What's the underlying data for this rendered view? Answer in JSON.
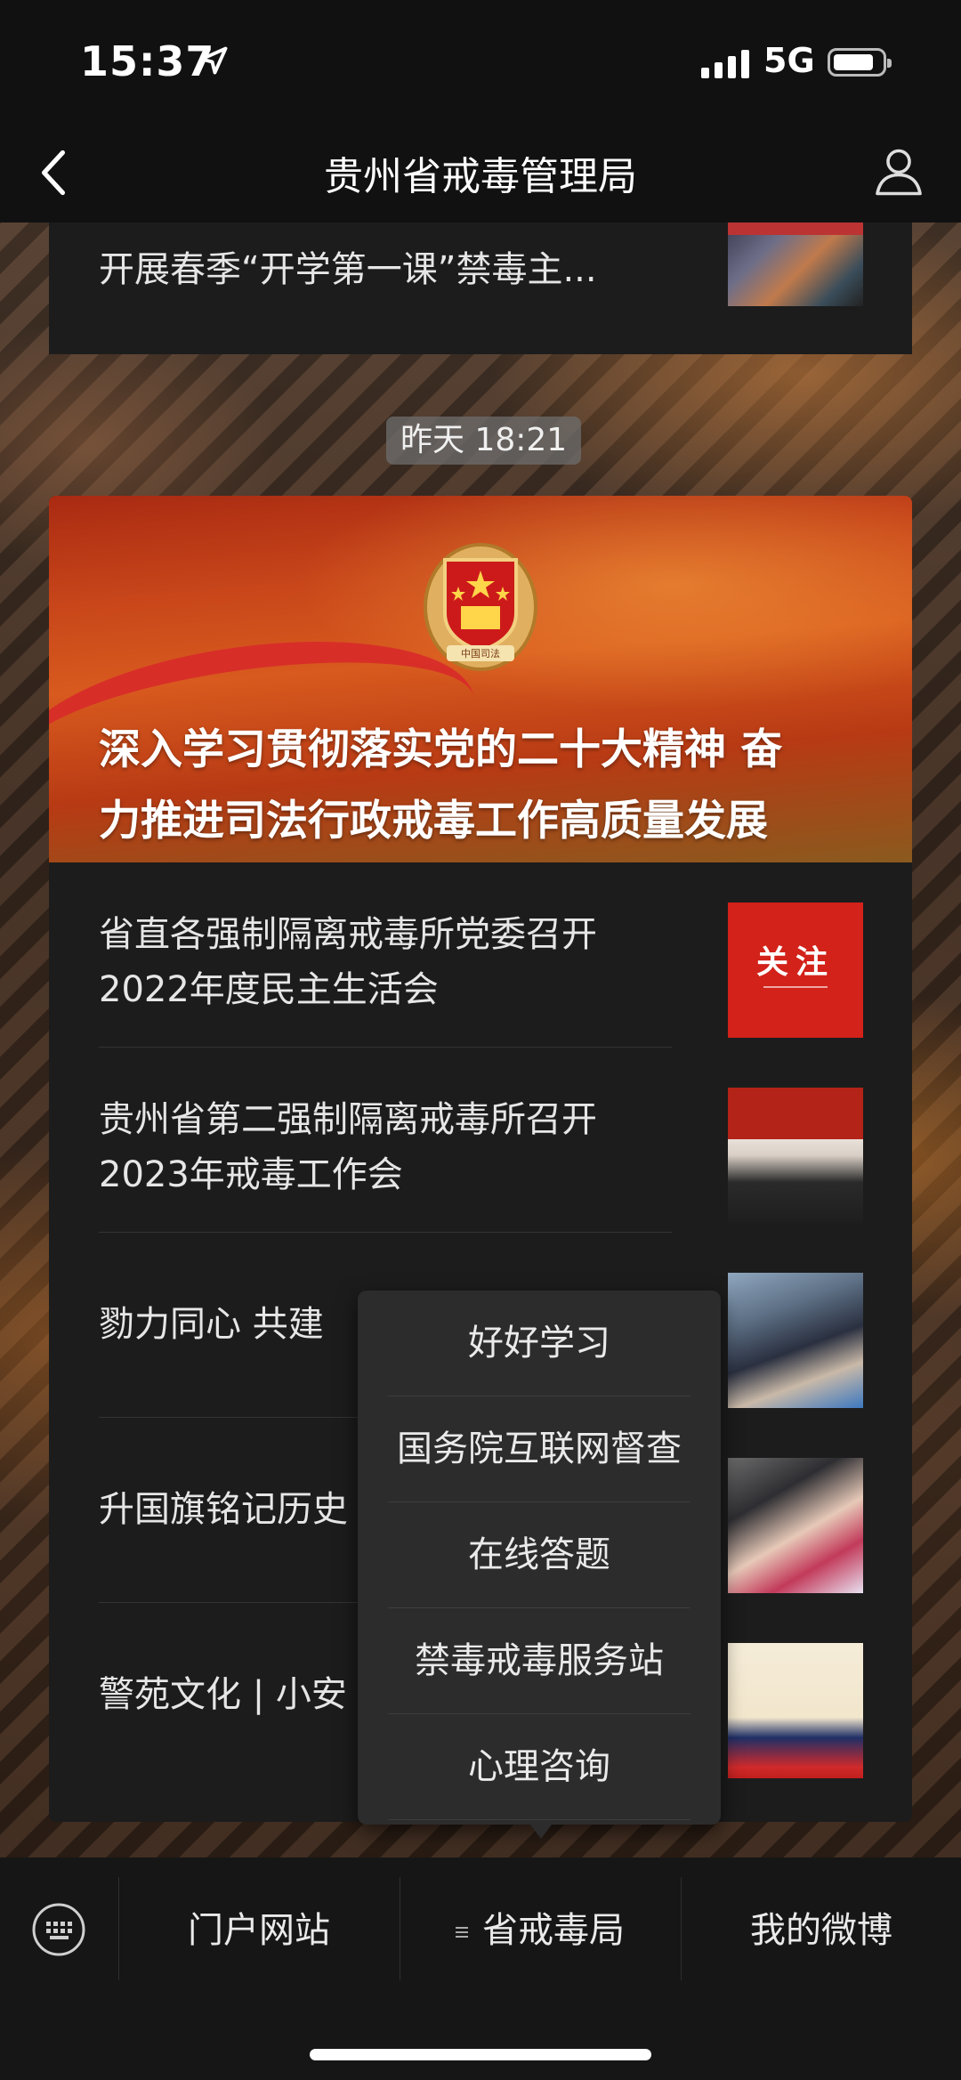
{
  "status_bar": {
    "time": "15:37",
    "network": "5G"
  },
  "nav": {
    "title": "贵州省戒毒管理局"
  },
  "previous_article": {
    "title": "开展春季“开学第一课”禁毒主..."
  },
  "timestamp": "昨天 18:21",
  "feature": {
    "headline_line1": "深入学习贯彻落实党的二十大精神 奋",
    "headline_line2": "力推进司法行政戒毒工作高质量发展",
    "emblem_text": "中国司法"
  },
  "articles": [
    {
      "line1": "省直各强制隔离戒毒所党委召开",
      "line2": "2022年度民主生活会",
      "thumb_text": "关注"
    },
    {
      "line1": "贵州省第二强制隔离戒毒所召开",
      "line2": "2023年戒毒工作会"
    },
    {
      "line1": "勠力同心  共建"
    },
    {
      "line1": "升国旗铭记历史"
    },
    {
      "line1": "警苑文化 | 小安"
    }
  ],
  "popup_menu": [
    "好好学习",
    "国务院互联网督查",
    "在线答题",
    "禁毒戒毒服务站",
    "心理咨询"
  ],
  "bottom_menu": {
    "item1": "门户网站",
    "item2": "省戒毒局",
    "item3": "我的微博"
  }
}
